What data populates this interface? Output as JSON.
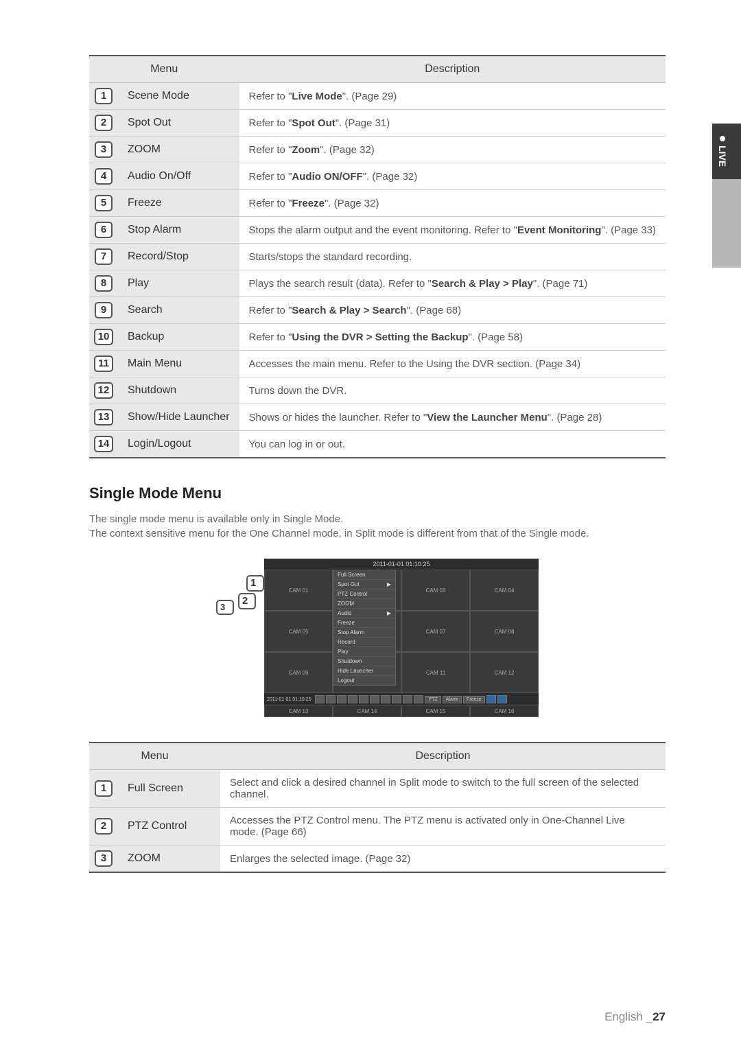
{
  "side_tab": "LIVE",
  "table1": {
    "head_menu": "Menu",
    "head_desc": "Description",
    "rows": [
      {
        "n": "1",
        "name": "Scene Mode",
        "desc_pre": "Refer to \"",
        "desc_bold": "Live Mode",
        "desc_post": "\". (Page 29)"
      },
      {
        "n": "2",
        "name": "Spot Out",
        "desc_pre": "Refer to \"",
        "desc_bold": "Spot Out",
        "desc_post": "\". (Page 31)"
      },
      {
        "n": "3",
        "name": "ZOOM",
        "desc_pre": "Refer to \"",
        "desc_bold": "Zoom",
        "desc_post": "\". (Page 32)"
      },
      {
        "n": "4",
        "name": "Audio On/Off",
        "desc_pre": "Refer to \"",
        "desc_bold": "Audio ON/OFF",
        "desc_post": "\". (Page 32)"
      },
      {
        "n": "5",
        "name": "Freeze",
        "desc_pre": "Refer to \"",
        "desc_bold": "Freeze",
        "desc_post": "\". (Page 32)"
      },
      {
        "n": "6",
        "name": "Stop Alarm",
        "desc_pre": "Stops the alarm output and the event monitoring. Refer to \"",
        "desc_bold": "Event Monitoring",
        "desc_post": "\". (Page 33)"
      },
      {
        "n": "7",
        "name": "Record/Stop",
        "desc_pre": "Starts/stops the standard recording.",
        "desc_bold": "",
        "desc_post": ""
      },
      {
        "n": "8",
        "name": "Play",
        "desc_pre": "Plays the search result (data). Refer to \"",
        "desc_bold": "Search & Play > Play",
        "desc_post": "\". (Page 71)"
      },
      {
        "n": "9",
        "name": "Search",
        "desc_pre": "Refer to \"",
        "desc_bold": "Search & Play > Search",
        "desc_post": "\". (Page 68)"
      },
      {
        "n": "10",
        "name": "Backup",
        "desc_pre": "Refer to \"",
        "desc_bold": "Using the DVR > Setting the Backup",
        "desc_post": "\". (Page 58)"
      },
      {
        "n": "11",
        "name": "Main Menu",
        "desc_pre": "Accesses the main menu. Refer to the Using the DVR section. (Page 34)",
        "desc_bold": "",
        "desc_post": ""
      },
      {
        "n": "12",
        "name": "Shutdown",
        "desc_pre": "Turns down the DVR.",
        "desc_bold": "",
        "desc_post": ""
      },
      {
        "n": "13",
        "name": "Show/Hide Launcher",
        "desc_pre": "Shows or hides the launcher. Refer to \"",
        "desc_bold": "View the Launcher Menu",
        "desc_post": "\". (Page 28)"
      },
      {
        "n": "14",
        "name": "Login/Logout",
        "desc_pre": "You can log in or out.",
        "desc_bold": "",
        "desc_post": ""
      }
    ]
  },
  "section_title": "Single Mode Menu",
  "intro_line1": "The single mode menu is available only in Single Mode.",
  "intro_line2": "The context sensitive menu for the One Channel mode, in Split mode is different from that of the Single mode.",
  "dvr": {
    "timestamp_top": "2011-01-01 01:10:25",
    "timestamp_tb": "2011-01-01 01:10:25",
    "cams": [
      "CAM 01",
      "",
      "CAM 03",
      "CAM 04",
      "CAM 05",
      "",
      "CAM 07",
      "CAM 08",
      "CAM 09",
      "",
      "CAM 11",
      "CAM 12"
    ],
    "footer": [
      "CAM 13",
      "CAM 14",
      "CAM 15",
      "CAM 16"
    ],
    "menu": [
      "Full Screen",
      "Spot Out",
      "PTZ Control",
      "ZOOM",
      "Audio",
      "Freeze",
      "Stop Alarm",
      "Record",
      "Play",
      "Shutdown",
      "Hide Launcher",
      "Logout"
    ],
    "menu_arrow": {
      "1": "▶",
      "4": "▶"
    },
    "chips": [
      "PTZ",
      "Alarm",
      "Freeze"
    ],
    "callouts": {
      "1": "1",
      "2": "2",
      "3": "3"
    }
  },
  "table2": {
    "head_menu": "Menu",
    "head_desc": "Description",
    "rows": [
      {
        "n": "1",
        "name": "Full Screen",
        "desc": "Select and click a desired channel in Split mode to switch to the full screen of the selected channel."
      },
      {
        "n": "2",
        "name": "PTZ Control",
        "desc": "Accesses the PTZ Control menu. The PTZ menu is activated only in One-Channel Live mode. (Page 66)"
      },
      {
        "n": "3",
        "name": "ZOOM",
        "desc": "Enlarges the selected image. (Page 32)"
      }
    ]
  },
  "footer": {
    "lang": "English",
    "sep": "_",
    "page": "27"
  }
}
